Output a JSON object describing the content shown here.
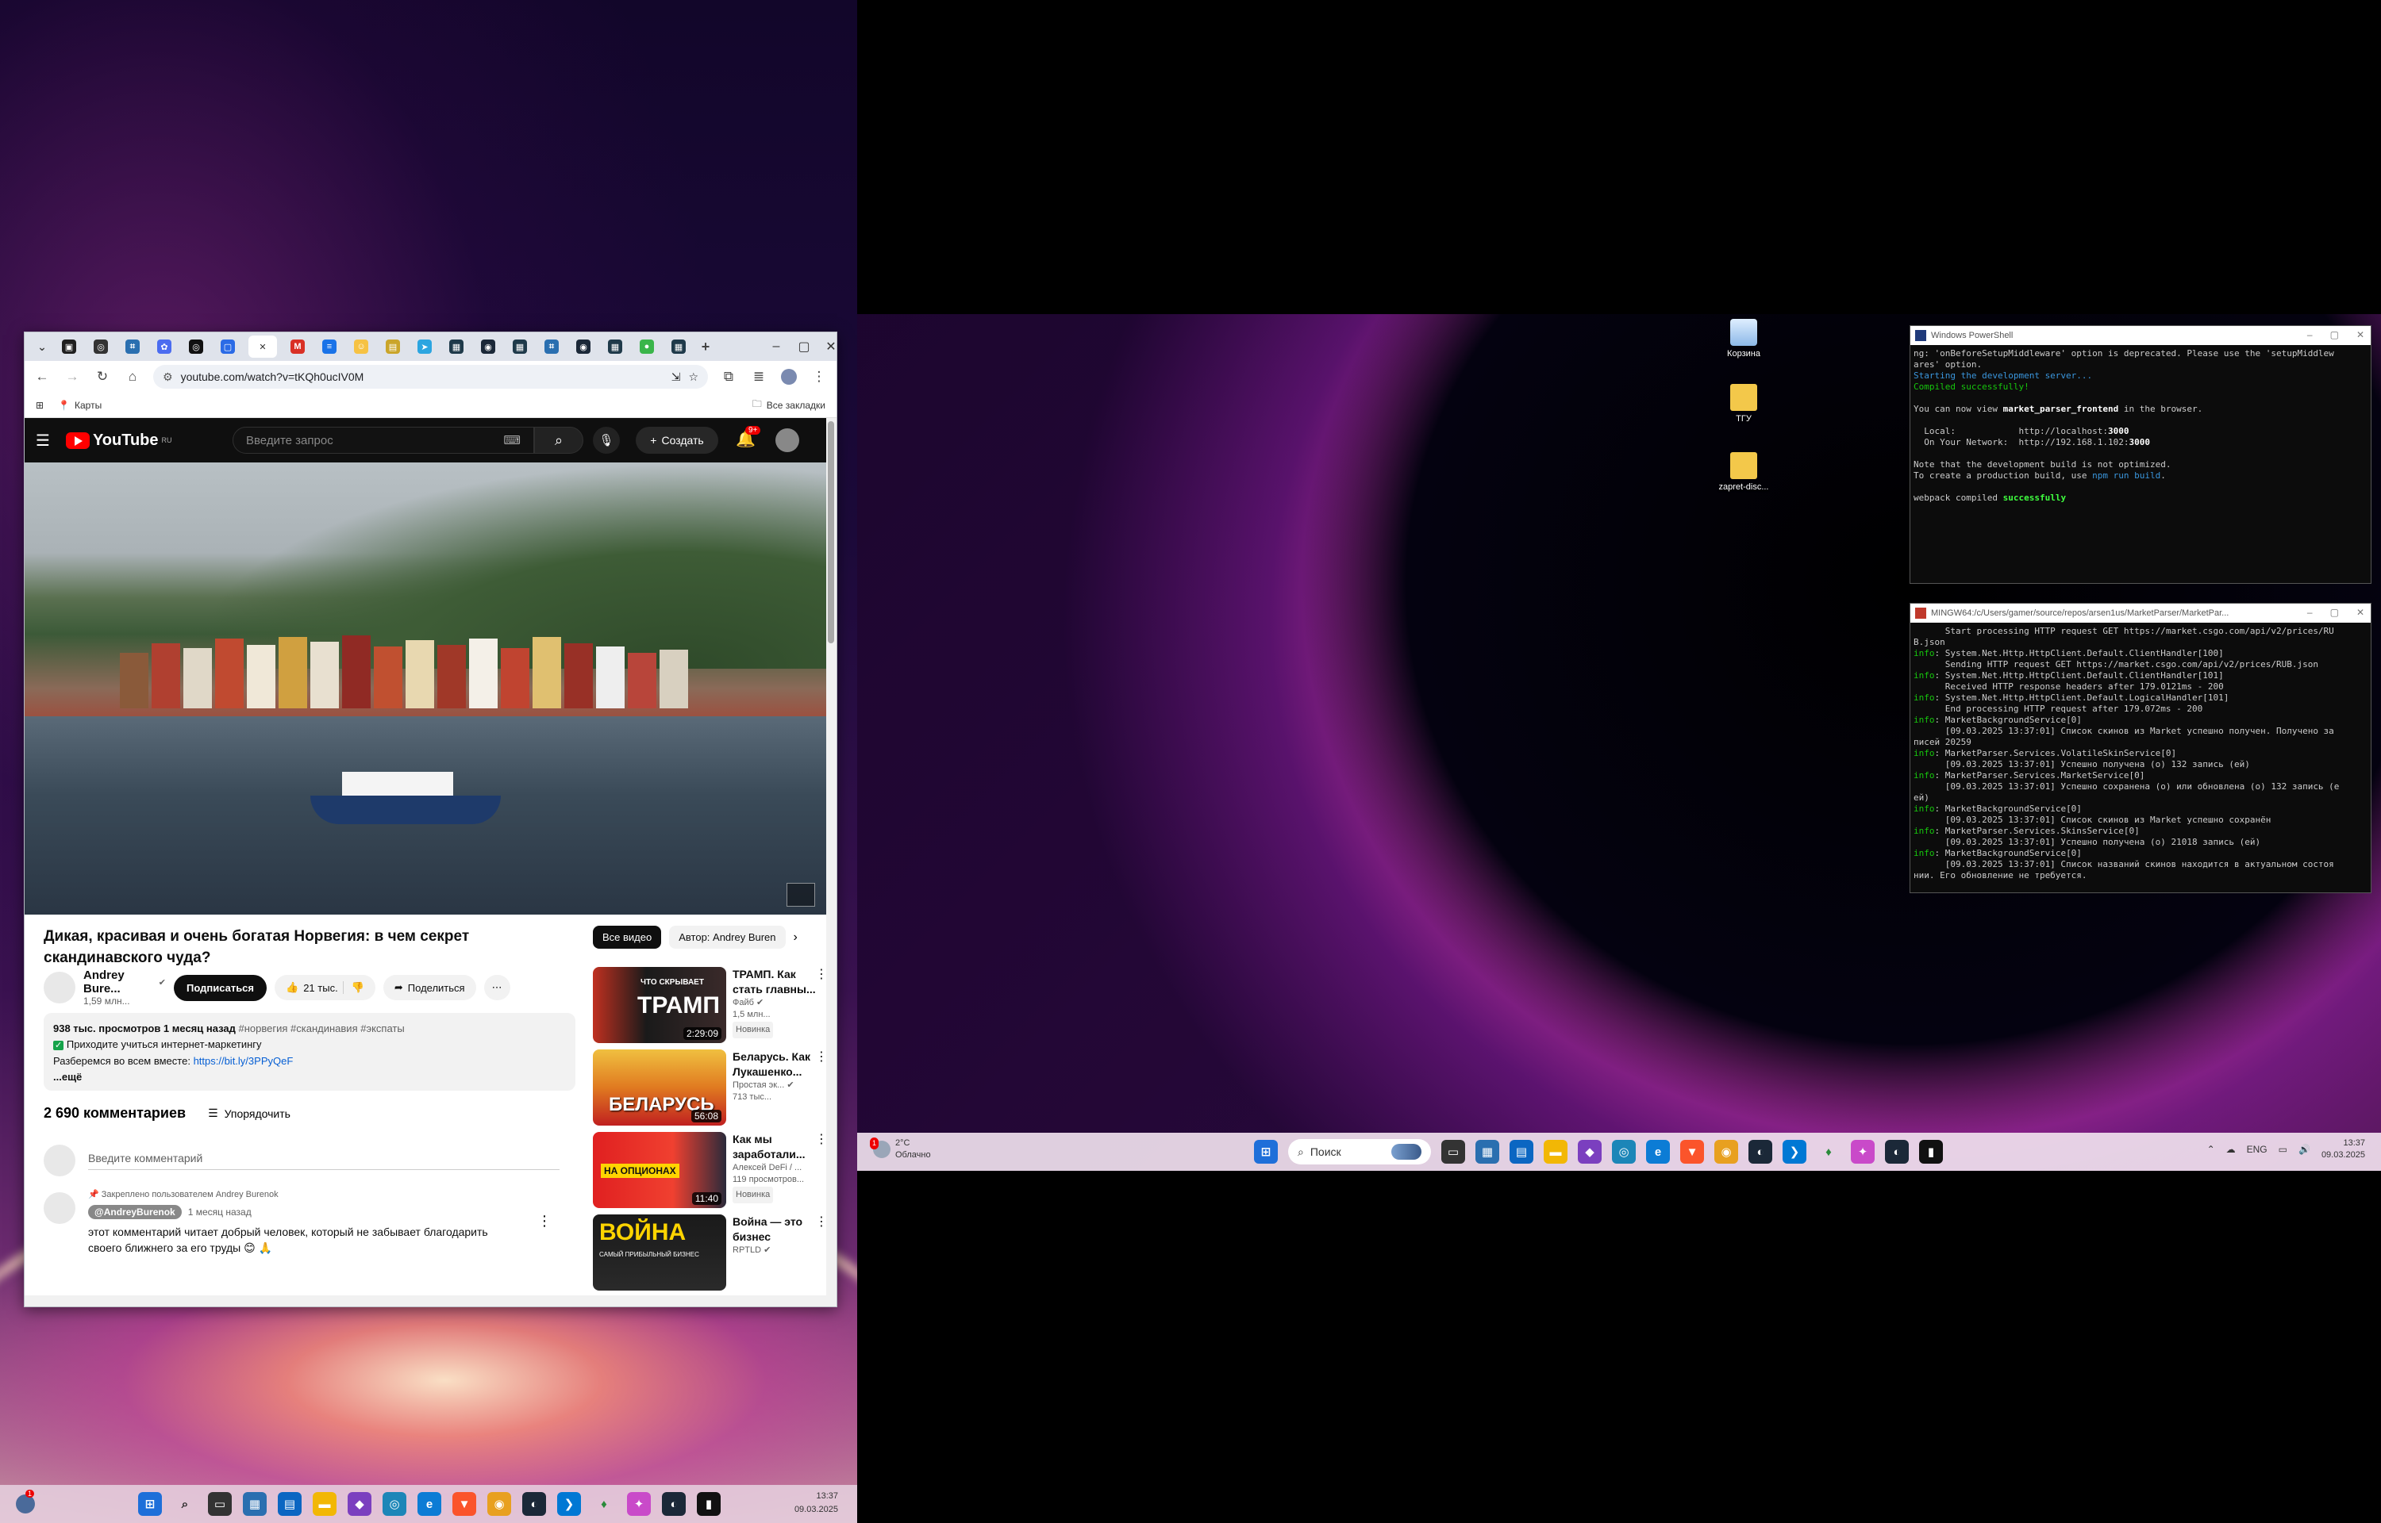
{
  "browser": {
    "url": "youtube.com/watch?v=tKQh0ucIV0M",
    "bookmarks": {
      "maps": "Карты",
      "all": "Все закладки"
    },
    "tabs": [
      {
        "icon": "tab-favicon",
        "color": "#1f1f1f",
        "glyph": "▣"
      },
      {
        "icon": "tab-favicon",
        "color": "#333333",
        "glyph": "◎"
      },
      {
        "icon": "tab-favicon",
        "color": "#2a6fb0",
        "glyph": "⌗"
      },
      {
        "icon": "tab-favicon",
        "color": "#4b6cf0",
        "glyph": "✿"
      },
      {
        "icon": "tab-favicon",
        "color": "#111111",
        "glyph": "◎"
      },
      {
        "icon": "tab-favicon",
        "color": "#2b6be6",
        "glyph": "▢"
      },
      {
        "icon": "tab-favicon",
        "color": "#ffffff",
        "glyph": "✕"
      },
      {
        "icon": "tab-favicon",
        "color": "#d93025",
        "glyph": "M"
      },
      {
        "icon": "tab-favicon",
        "color": "#1a73e8",
        "glyph": "≡"
      },
      {
        "icon": "tab-favicon",
        "color": "#f6c244",
        "glyph": "☺"
      },
      {
        "icon": "tab-favicon",
        "color": "#caa52a",
        "glyph": "▤"
      },
      {
        "icon": "tab-favicon",
        "color": "#2ca5e0",
        "glyph": "➤"
      },
      {
        "icon": "tab-favicon",
        "color": "#1f3a4a",
        "glyph": "▦"
      },
      {
        "icon": "tab-favicon",
        "color": "#1b2838",
        "glyph": "◉"
      },
      {
        "icon": "tab-favicon",
        "color": "#1f3a4a",
        "glyph": "▦"
      },
      {
        "icon": "tab-favicon",
        "color": "#2a6fb0",
        "glyph": "⌗"
      },
      {
        "icon": "tab-favicon",
        "color": "#1b2838",
        "glyph": "◉"
      },
      {
        "icon": "tab-favicon",
        "color": "#1f3a4a",
        "glyph": "▦"
      },
      {
        "icon": "tab-favicon",
        "color": "#3ab54a",
        "glyph": "●"
      },
      {
        "icon": "tab-favicon",
        "color": "#1f3a4a",
        "glyph": "▦"
      }
    ]
  },
  "youtube": {
    "logo": "YouTube",
    "region": "RU",
    "search_placeholder": "Введите запрос",
    "create": "Создать",
    "notifications": "9+",
    "video": {
      "title": "Дикая, красивая и очень богатая Норвегия: в чем секрет скандинавского чуда?",
      "channel": "Andrey Bure...",
      "subs": "1,59 млн...",
      "subscribe": "Подписаться",
      "likes": "21 тыс.",
      "share": "Поделиться",
      "desc_stats": "938 тыс. просмотров  1 месяц назад",
      "desc_tags": "#норвегия #скандинавия #экспаты",
      "desc_line2": "Приходите учиться интернет-маркетингу",
      "desc_line3": "Разберемся во всем вместе:",
      "desc_link": "https://bit.ly/3PPyQeF",
      "desc_more": "...ещё"
    },
    "comments": {
      "count": "2 690 комментариев",
      "sort": "Упорядочить",
      "input_placeholder": "Введите комментарий",
      "pinned": "Закреплено пользователем Andrey Burenok",
      "author": "@AndreyBurenok",
      "time": "1 месяц назад",
      "text1": "этот комментарий читает добрый человек, который не забывает благодарить",
      "text2": "своего ближнего за его труды 😊 🙏"
    },
    "chips": {
      "all": "Все видео",
      "author": "Автор: Andrey Buren"
    },
    "recs": [
      {
        "title1": "ТРАМП. Как",
        "title2": "стать главны...",
        "channel": "Файб",
        "meta": "1,5 млн...",
        "badge": "Новинка",
        "duration": "2:29:09",
        "thumb_text": "ТРАМП",
        "thumb_sub": "ЧТО СКРЫВАЕТ"
      },
      {
        "title1": "Беларусь. Как",
        "title2": "Лукашенко...",
        "channel": "Простая эк...",
        "meta": "713 тыс...",
        "badge": "",
        "duration": "56:08",
        "thumb_text": "БЕЛАРУСЬ",
        "thumb_sub": ""
      },
      {
        "title1": "Как мы",
        "title2": "заработали...",
        "channel": "Алексей DeFi / ...",
        "meta": "119 просмотров...",
        "badge": "Новинка",
        "duration": "11:40",
        "thumb_text": "НА ОПЦИОНАХ",
        "thumb_sub": ""
      },
      {
        "title1": "Война — это",
        "title2": "бизнес",
        "channel": "RPTLD",
        "meta": "",
        "badge": "",
        "duration": "",
        "thumb_text": "ВОЙНА",
        "thumb_sub": "САМЫЙ ПРИБЫЛЬНЫЙ БИЗНЕС"
      }
    ]
  },
  "taskbar_left": {
    "time": "13:37",
    "date": "09.03.2025",
    "notif": "1"
  },
  "desktop_icons": [
    "Корзина",
    "ТГУ",
    "zapret-disc..."
  ],
  "powershell": {
    "title": "Windows PowerShell",
    "lines": [
      {
        "t": "ng: 'onBeforeSetupMiddleware' option is deprecated. Please use the 'setupMiddlew",
        "c": ""
      },
      {
        "t": "ares' option.",
        "c": ""
      },
      {
        "t": "Starting the development server...",
        "c": "c-cyan"
      },
      {
        "t": "Compiled successfully!",
        "c": "c-green"
      },
      {
        "t": "",
        "c": ""
      },
      {
        "t": "You can now view market_parser_frontend in the browser.",
        "c": ""
      },
      {
        "t": "",
        "c": ""
      },
      {
        "t": "  Local:            http://localhost:3000",
        "c": ""
      },
      {
        "t": "  On Your Network:  http://192.168.1.102:3000",
        "c": ""
      },
      {
        "t": "",
        "c": ""
      },
      {
        "t": "Note that the development build is not optimized.",
        "c": ""
      },
      {
        "t": "To create a production build, use npm run build.",
        "c": ""
      },
      {
        "t": "",
        "c": ""
      },
      {
        "t": "webpack compiled successfully",
        "c": ""
      }
    ]
  },
  "mingw": {
    "title": "MINGW64:/c/Users/gamer/source/repos/arsen1us/MarketParser/MarketPar...",
    "lines": [
      {
        "p": "",
        "t": "      Start processing HTTP request GET https://market.csgo.com/api/v2/prices/RU"
      },
      {
        "p": "",
        "t": "B.json"
      },
      {
        "p": "info",
        "t": ": System.Net.Http.HttpClient.Default.ClientHandler[100]"
      },
      {
        "p": "",
        "t": "      Sending HTTP request GET https://market.csgo.com/api/v2/prices/RUB.json"
      },
      {
        "p": "info",
        "t": ": System.Net.Http.HttpClient.Default.ClientHandler[101]"
      },
      {
        "p": "",
        "t": "      Received HTTP response headers after 179.0121ms - 200"
      },
      {
        "p": "info",
        "t": ": System.Net.Http.HttpClient.Default.LogicalHandler[101]"
      },
      {
        "p": "",
        "t": "      End processing HTTP request after 179.072ms - 200"
      },
      {
        "p": "info",
        "t": ": MarketBackgroundService[0]"
      },
      {
        "p": "",
        "t": "      [09.03.2025 13:37:01] Список скинов из Market успешно получен. Получено за"
      },
      {
        "p": "",
        "t": "писей 20259"
      },
      {
        "p": "info",
        "t": ": MarketParser.Services.VolatileSkinService[0]"
      },
      {
        "p": "",
        "t": "      [09.03.2025 13:37:01] Успешно получена (о) 132 запись (ей)"
      },
      {
        "p": "info",
        "t": ": MarketParser.Services.MarketService[0]"
      },
      {
        "p": "",
        "t": "      [09.03.2025 13:37:01] Успешно сохранена (о) или обновлена (о) 132 запись (е"
      },
      {
        "p": "",
        "t": "ей)"
      },
      {
        "p": "info",
        "t": ": MarketBackgroundService[0]"
      },
      {
        "p": "",
        "t": "      [09.03.2025 13:37:01] Список скинов из Market успешно сохранён"
      },
      {
        "p": "info",
        "t": ": MarketParser.Services.SkinsService[0]"
      },
      {
        "p": "",
        "t": "      [09.03.2025 13:37:01] Успешно получена (о) 21018 запись (ей)"
      },
      {
        "p": "info",
        "t": ": MarketBackgroundService[0]"
      },
      {
        "p": "",
        "t": "      [09.03.2025 13:37:01] Список названий скинов находится в актуальном состоя"
      },
      {
        "p": "",
        "t": "нии. Его обновление не требуется."
      }
    ]
  },
  "taskbar_right": {
    "weather_temp": "2°C",
    "weather_desc": "Облачно",
    "weather_notif": "1",
    "search": "Поиск",
    "lang": "ENG",
    "time": "13:37",
    "date": "09.03.2025"
  }
}
